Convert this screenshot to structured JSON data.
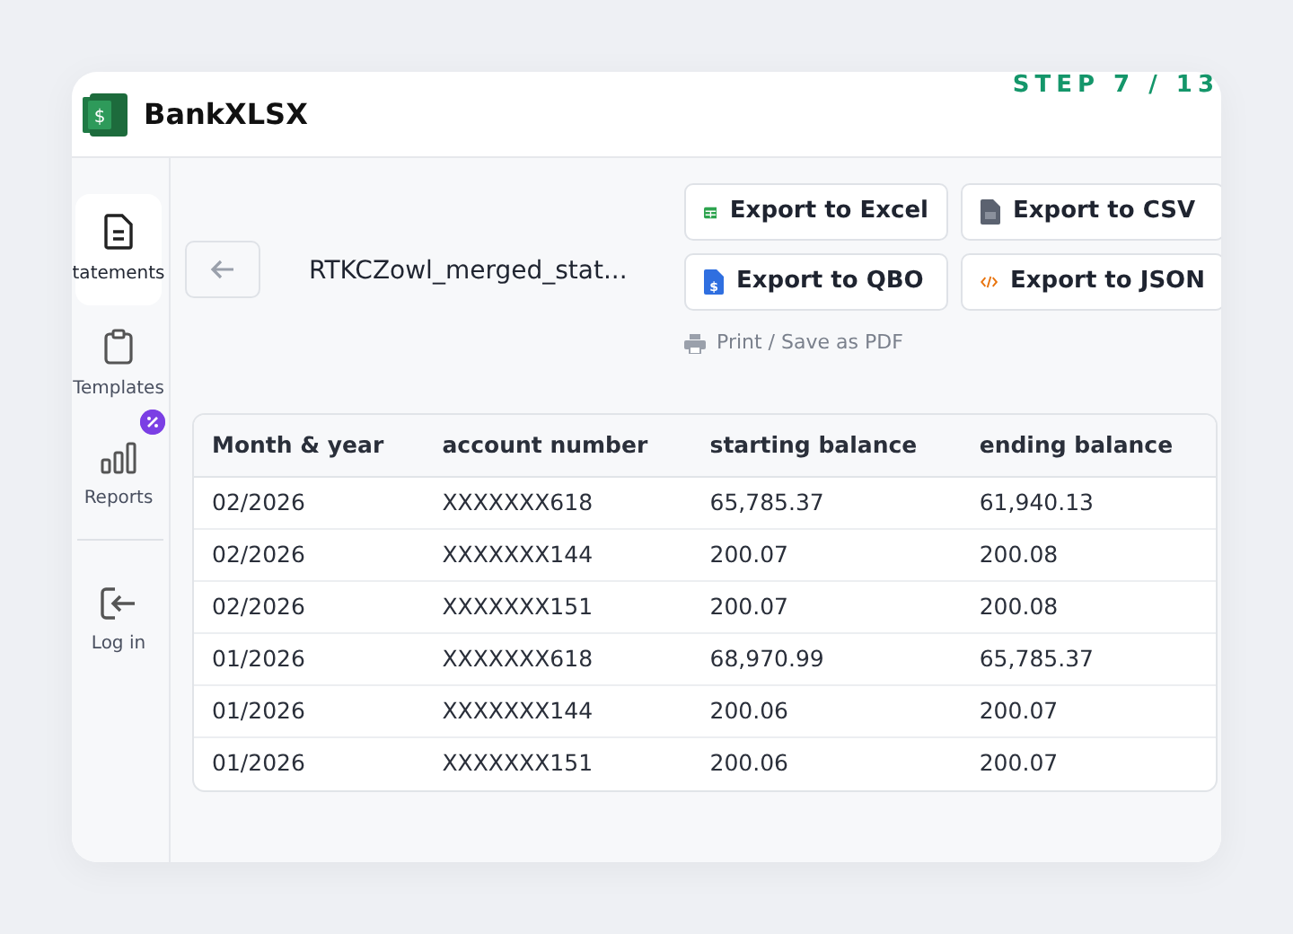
{
  "step": "STEP 7 / 13",
  "brand": {
    "name": "BankXLSX",
    "symbol": "$"
  },
  "sidebar": {
    "items": [
      {
        "kind": "document",
        "label": "tatements",
        "selected": true,
        "badge": false
      },
      {
        "kind": "clipboard",
        "label": "Templates",
        "selected": false,
        "badge": false
      },
      {
        "kind": "chart",
        "label": "Reports",
        "selected": false,
        "badge": true
      },
      {
        "kind": "login",
        "label": "Log in",
        "selected": false,
        "badge": false
      }
    ]
  },
  "file_title": "RTKCZowl_merged_stat...",
  "exports": [
    {
      "kind": "excel",
      "label": "Export to Excel"
    },
    {
      "kind": "csv",
      "label": "Export to CSV"
    },
    {
      "kind": "qbo",
      "label": "Export to QBO",
      "symbol": "$"
    },
    {
      "kind": "json",
      "label": "Export to JSON"
    }
  ],
  "print_link": "Print / Save as PDF",
  "table": {
    "columns": [
      "Month & year",
      "account number",
      "starting balance",
      "ending balance"
    ],
    "rows": [
      [
        "02/2026",
        "XXXXXXX618",
        "65,785.37",
        "61,940.13"
      ],
      [
        "02/2026",
        "XXXXXXX144",
        "200.07",
        "200.08"
      ],
      [
        "02/2026",
        "XXXXXXX151",
        "200.07",
        "200.08"
      ],
      [
        "01/2026",
        "XXXXXXX618",
        "68,970.99",
        "65,785.37"
      ],
      [
        "01/2026",
        "XXXXXXX144",
        "200.06",
        "200.07"
      ],
      [
        "01/2026",
        "XXXXXXX151",
        "200.06",
        "200.07"
      ]
    ]
  }
}
